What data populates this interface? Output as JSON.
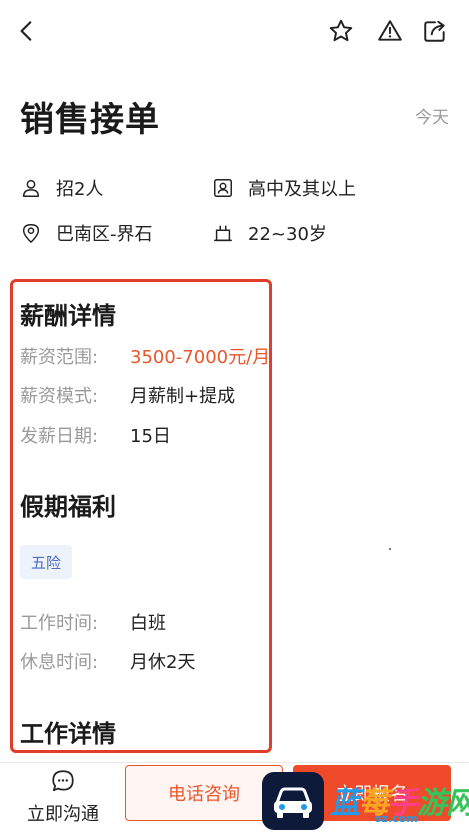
{
  "header": {
    "back_icon": "chevron-left-icon",
    "actions": [
      "star-icon",
      "warning-icon",
      "share-icon"
    ]
  },
  "job": {
    "title": "销售接单",
    "date": "今天",
    "recruit": "招2人",
    "education": "高中及其以上",
    "location": "巴南区-界石",
    "age": "22~30岁"
  },
  "salary_section": {
    "title": "薪酬详情",
    "rows": [
      {
        "label": "薪资范围:",
        "value": "3500-7000元/月"
      },
      {
        "label": "薪资模式:",
        "value": "月薪制+提成"
      },
      {
        "label": "发薪日期:",
        "value": "15日"
      }
    ]
  },
  "benefits_section": {
    "title": "假期福利",
    "tag": "五险",
    "rows": [
      {
        "label": "工作时间:",
        "value": "白班"
      },
      {
        "label": "休息时间:",
        "value": "月休2天"
      }
    ]
  },
  "detail_section": {
    "title": "工作详情"
  },
  "bottom": {
    "chat_label": "立即沟通",
    "phone_label": "电话咨询",
    "apply_label": "立即报名"
  },
  "watermark": {
    "text_1": "蓝",
    "text_2": "莓",
    "text_3": "手",
    "text_4": "游网",
    "url": "sz.com"
  },
  "colors": {
    "accent": "#ef4a2a",
    "salary": "#e8562c",
    "highlight_box": "#e23d2c",
    "tag_bg": "#eef2fb",
    "tag_text": "#4a6cc2"
  }
}
